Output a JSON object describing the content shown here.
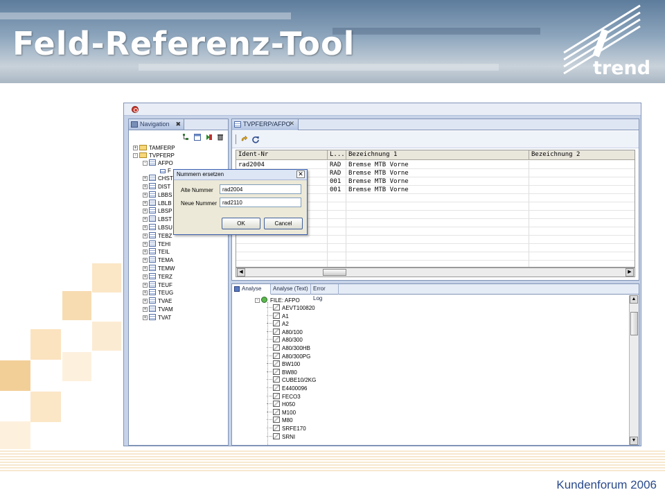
{
  "slide": {
    "title": "Feld-Referenz-Tool",
    "logo_text": "trend",
    "footer": "Kundenforum 2006"
  },
  "colors": {
    "accent_blue": "#2a4a8c",
    "decor_orange": "#f3cf98"
  },
  "app": {
    "navigation": {
      "tab_label": "Navigation",
      "icons": [
        "stop-icon",
        "hierarchy-icon",
        "table-icon",
        "run-icon",
        "delete-icon"
      ],
      "tree": [
        {
          "label": "TAMFERP",
          "type": "folder",
          "expander": "+"
        },
        {
          "label": "TVPFERP",
          "type": "folder",
          "expander": "-"
        },
        {
          "label": "AFPO",
          "type": "table",
          "expander": "-",
          "selected": true
        },
        {
          "label": "F",
          "type": "field"
        },
        {
          "label": "CHST",
          "type": "table",
          "expander": "+"
        },
        {
          "label": "DIST",
          "type": "table",
          "expander": "+"
        },
        {
          "label": "LBBS",
          "type": "table",
          "expander": "+"
        },
        {
          "label": "LBLB",
          "type": "table",
          "expander": "+"
        },
        {
          "label": "LBSP",
          "type": "table",
          "expander": "+"
        },
        {
          "label": "LBST",
          "type": "table",
          "expander": "+"
        },
        {
          "label": "LBSU",
          "type": "table",
          "expander": "+"
        },
        {
          "label": "TEBZ",
          "type": "table",
          "expander": "+"
        },
        {
          "label": "TEHI",
          "type": "table",
          "expander": "+"
        },
        {
          "label": "TEIL",
          "type": "table",
          "expander": "+"
        },
        {
          "label": "TEMA",
          "type": "table",
          "expander": "+"
        },
        {
          "label": "TEMW",
          "type": "table",
          "expander": "+"
        },
        {
          "label": "TERZ",
          "type": "table",
          "expander": "+"
        },
        {
          "label": "TEUF",
          "type": "table",
          "expander": "+"
        },
        {
          "label": "TEUG",
          "type": "table",
          "expander": "+"
        },
        {
          "label": "TVAE",
          "type": "table",
          "expander": "+"
        },
        {
          "label": "TVAM",
          "type": "table",
          "expander": "+"
        },
        {
          "label": "TVAT",
          "type": "table",
          "expander": "+"
        }
      ]
    },
    "editor": {
      "tab_label": "TVPFERP/AFPO",
      "columns": [
        "Ident-Nr",
        "L...",
        "Bezeichnung 1",
        "Bezeichnung 2"
      ],
      "rows": [
        [
          "rad2004",
          "RAD",
          "Bremse MTB Vorne",
          ""
        ],
        [
          "",
          "RAD",
          "Bremse MTB Vorne",
          ""
        ],
        [
          "",
          "001",
          "Bremse MTB Vorne",
          ""
        ],
        [
          "",
          "001",
          "Bremse MTB Vorne",
          ""
        ]
      ]
    },
    "bottom": {
      "tabs": [
        "Analyse",
        "Analyse (Text)",
        "Error Log"
      ],
      "active_tab": "Analyse",
      "file_node": "FILE: AFPO",
      "items": [
        "AEVT100820",
        "A1",
        "A2",
        "A80/100",
        "A80/300",
        "A80/300HB",
        "A80/300PG",
        "BW100",
        "BW80",
        "CUBE10/2KG",
        "E4400096",
        "FECO3",
        "H050",
        "M100",
        "M80",
        "SRFE170",
        "SRNI"
      ]
    },
    "dialog": {
      "title": "Nummern ersetzen",
      "old_label": "Alte Nummer",
      "old_value": "rad2004",
      "new_label": "Neue Nummer",
      "new_value": "rad2110",
      "ok_label": "OK",
      "cancel_label": "Cancel"
    }
  }
}
